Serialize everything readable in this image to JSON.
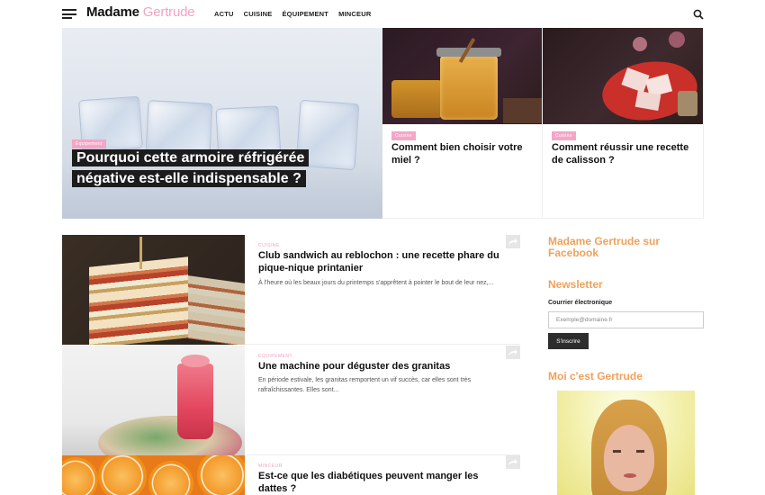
{
  "header": {
    "logo_part1": "Madame",
    "logo_part2": "Gertrude",
    "nav": [
      "ACTU",
      "CUISINE",
      "ÉQUIPEMENT",
      "MINCEUR"
    ]
  },
  "hero": {
    "tag": "Équipement",
    "title": "Pourquoi cette armoire réfrigérée négative est-elle indispensable ?"
  },
  "cards": [
    {
      "tag": "Cuisine",
      "title": "Comment bien choisir votre miel ?"
    },
    {
      "tag": "Cuisine",
      "title": "Comment réussir une recette de calisson ?"
    }
  ],
  "articles": [
    {
      "category": "CUISINE",
      "title": "Club sandwich au reblochon : une recette phare du pique-nique printanier",
      "excerpt": "À l'heure où les beaux jours du printemps s'apprêtent à pointer le bout de leur nez,..."
    },
    {
      "category": "ÉQUIPEMENT",
      "title": "Une machine pour déguster des granitas",
      "excerpt": "En période estivale, les granitas remportent un vif succès, car elles sont très rafraîchissantes. Elles sont..."
    },
    {
      "category": "MINCEUR",
      "title": "Est-ce que les diabétiques peuvent manger les dattes ?",
      "excerpt": ""
    }
  ],
  "sidebar": {
    "facebook_heading": "Madame Gertrude sur Facebook",
    "newsletter_heading": "Newsletter",
    "email_label": "Courrier électronique",
    "email_placeholder": "Exemple@domaine.fr",
    "subscribe_label": "S'inscrire",
    "about_heading": "Moi c'est Gertrude"
  },
  "colors": {
    "accent_pink": "#f4a6c6",
    "sidebar_orange": "#f0a15a",
    "dark": "#1c1c1c"
  }
}
